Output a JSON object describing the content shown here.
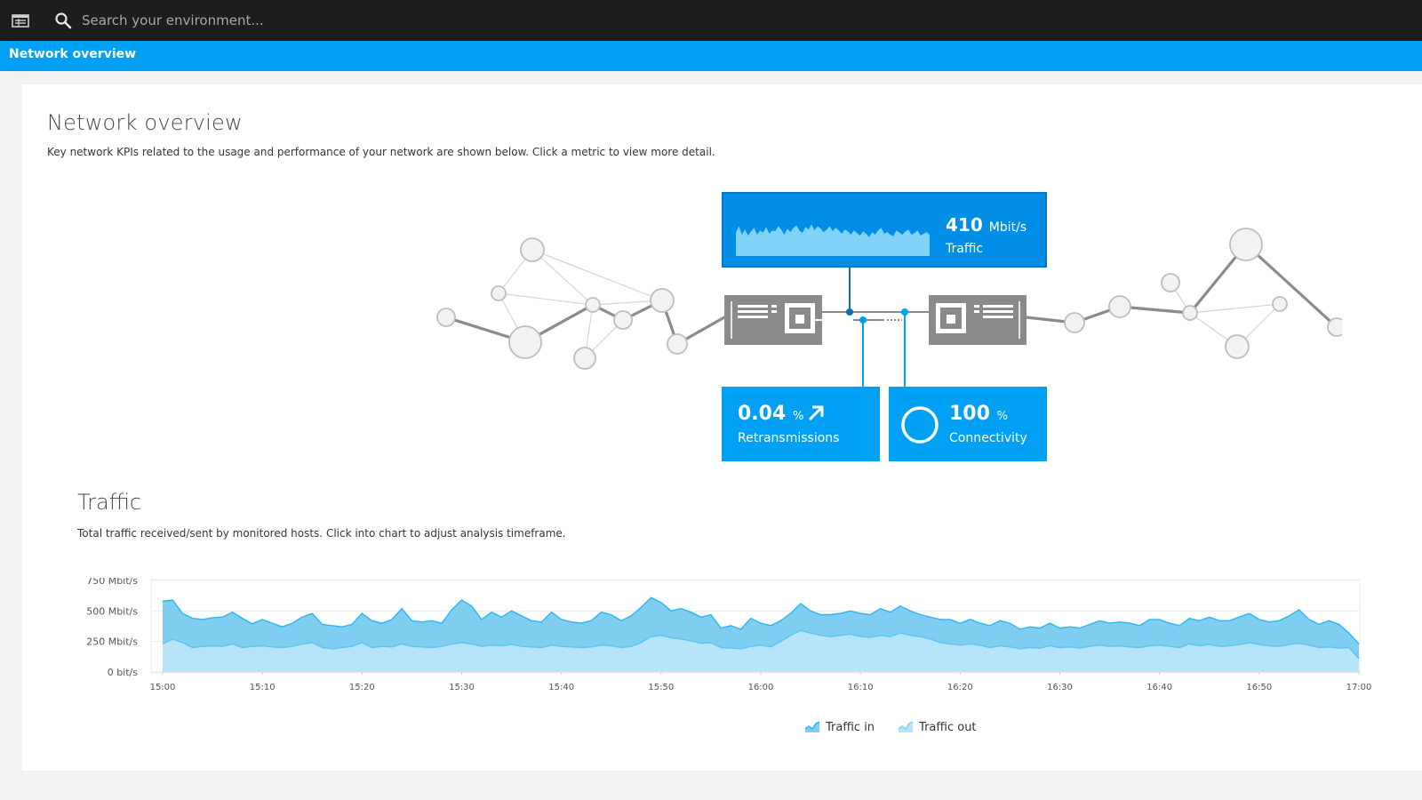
{
  "topbar": {
    "search_placeholder": "Search your environment..."
  },
  "titlebar": {
    "title": "Network overview"
  },
  "overview": {
    "title": "Network overview",
    "description": "Key network KPIs related to the usage and performance of your network are shown below. Click a metric to view more detail."
  },
  "kpis": {
    "traffic": {
      "value": "410",
      "unit": "Mbit/s",
      "label": "Traffic"
    },
    "retransmissions": {
      "value": "0.04",
      "unit": "%",
      "label": "Retransmissions"
    },
    "connectivity": {
      "value": "100",
      "unit": "%",
      "label": "Connectivity"
    }
  },
  "traffic_section": {
    "title": "Traffic",
    "description": "Total traffic received/sent by monitored hosts. Click into chart to adjust analysis timeframe."
  },
  "colors": {
    "accent": "#00a1f5",
    "traffic_in": "#7fcdf1",
    "traffic_out": "#b6e5fa",
    "topbar": "#1d1d1d"
  },
  "chart_data": {
    "type": "area",
    "y_unit_labels": [
      "0 bit/s",
      "250 Mbit/s",
      "500 Mbit/s",
      "750 Mbit/s"
    ],
    "y_ticks": [
      0,
      250,
      500,
      750
    ],
    "ylim": [
      0,
      750
    ],
    "x_tick_labels": [
      "15:00",
      "15:10",
      "15:20",
      "15:30",
      "15:40",
      "15:50",
      "16:00",
      "16:10",
      "16:20",
      "16:30",
      "16:40",
      "16:50",
      "17:00"
    ],
    "x_range_minutes": [
      0,
      120
    ],
    "grid": true,
    "legend_position": "bottom-center",
    "series": [
      {
        "name": "Traffic in",
        "points": [
          [
            0,
            580
          ],
          [
            1,
            590
          ],
          [
            2,
            480
          ],
          [
            3,
            440
          ],
          [
            4,
            430
          ],
          [
            5,
            445
          ],
          [
            6,
            450
          ],
          [
            7,
            490
          ],
          [
            8,
            440
          ],
          [
            9,
            395
          ],
          [
            10,
            430
          ],
          [
            11,
            400
          ],
          [
            12,
            370
          ],
          [
            13,
            400
          ],
          [
            14,
            450
          ],
          [
            15,
            480
          ],
          [
            16,
            390
          ],
          [
            17,
            380
          ],
          [
            18,
            370
          ],
          [
            19,
            390
          ],
          [
            20,
            480
          ],
          [
            21,
            420
          ],
          [
            22,
            400
          ],
          [
            23,
            430
          ],
          [
            24,
            520
          ],
          [
            25,
            420
          ],
          [
            26,
            410
          ],
          [
            27,
            420
          ],
          [
            28,
            400
          ],
          [
            29,
            510
          ],
          [
            30,
            590
          ],
          [
            31,
            540
          ],
          [
            32,
            430
          ],
          [
            33,
            490
          ],
          [
            34,
            450
          ],
          [
            35,
            500
          ],
          [
            36,
            460
          ],
          [
            37,
            420
          ],
          [
            38,
            410
          ],
          [
            39,
            490
          ],
          [
            40,
            430
          ],
          [
            41,
            410
          ],
          [
            42,
            400
          ],
          [
            43,
            420
          ],
          [
            44,
            490
          ],
          [
            45,
            470
          ],
          [
            46,
            420
          ],
          [
            47,
            460
          ],
          [
            48,
            530
          ],
          [
            49,
            610
          ],
          [
            50,
            570
          ],
          [
            51,
            500
          ],
          [
            52,
            520
          ],
          [
            53,
            490
          ],
          [
            54,
            450
          ],
          [
            55,
            470
          ],
          [
            56,
            360
          ],
          [
            57,
            380
          ],
          [
            58,
            350
          ],
          [
            59,
            440
          ],
          [
            60,
            400
          ],
          [
            61,
            380
          ],
          [
            62,
            420
          ],
          [
            63,
            480
          ],
          [
            64,
            560
          ],
          [
            65,
            500
          ],
          [
            66,
            470
          ],
          [
            67,
            470
          ],
          [
            68,
            480
          ],
          [
            69,
            500
          ],
          [
            70,
            480
          ],
          [
            71,
            470
          ],
          [
            72,
            520
          ],
          [
            73,
            490
          ],
          [
            74,
            540
          ],
          [
            75,
            500
          ],
          [
            76,
            470
          ],
          [
            77,
            450
          ],
          [
            78,
            430
          ],
          [
            79,
            430
          ],
          [
            80,
            400
          ],
          [
            81,
            430
          ],
          [
            82,
            400
          ],
          [
            83,
            380
          ],
          [
            84,
            420
          ],
          [
            85,
            400
          ],
          [
            86,
            350
          ],
          [
            87,
            370
          ],
          [
            88,
            360
          ],
          [
            89,
            400
          ],
          [
            90,
            360
          ],
          [
            91,
            370
          ],
          [
            92,
            360
          ],
          [
            93,
            390
          ],
          [
            94,
            420
          ],
          [
            95,
            400
          ],
          [
            96,
            410
          ],
          [
            97,
            400
          ],
          [
            98,
            380
          ],
          [
            99,
            430
          ],
          [
            100,
            430
          ],
          [
            101,
            400
          ],
          [
            102,
            380
          ],
          [
            103,
            440
          ],
          [
            104,
            420
          ],
          [
            105,
            450
          ],
          [
            106,
            420
          ],
          [
            107,
            420
          ],
          [
            108,
            450
          ],
          [
            109,
            480
          ],
          [
            110,
            430
          ],
          [
            111,
            410
          ],
          [
            112,
            420
          ],
          [
            113,
            460
          ],
          [
            114,
            510
          ],
          [
            115,
            430
          ],
          [
            116,
            390
          ],
          [
            117,
            420
          ],
          [
            118,
            390
          ],
          [
            119,
            320
          ],
          [
            120,
            230
          ]
        ]
      },
      {
        "name": "Traffic out",
        "points": [
          [
            0,
            230
          ],
          [
            1,
            270
          ],
          [
            2,
            240
          ],
          [
            3,
            200
          ],
          [
            4,
            210
          ],
          [
            5,
            215
          ],
          [
            6,
            210
          ],
          [
            7,
            230
          ],
          [
            8,
            200
          ],
          [
            9,
            210
          ],
          [
            10,
            215
          ],
          [
            11,
            205
          ],
          [
            12,
            200
          ],
          [
            13,
            210
          ],
          [
            14,
            230
          ],
          [
            15,
            240
          ],
          [
            16,
            200
          ],
          [
            17,
            190
          ],
          [
            18,
            200
          ],
          [
            19,
            210
          ],
          [
            20,
            240
          ],
          [
            21,
            200
          ],
          [
            22,
            210
          ],
          [
            23,
            205
          ],
          [
            24,
            230
          ],
          [
            25,
            210
          ],
          [
            26,
            205
          ],
          [
            27,
            200
          ],
          [
            28,
            210
          ],
          [
            29,
            230
          ],
          [
            30,
            240
          ],
          [
            31,
            230
          ],
          [
            32,
            210
          ],
          [
            33,
            220
          ],
          [
            34,
            215
          ],
          [
            35,
            225
          ],
          [
            36,
            210
          ],
          [
            37,
            205
          ],
          [
            38,
            200
          ],
          [
            39,
            220
          ],
          [
            40,
            210
          ],
          [
            41,
            205
          ],
          [
            42,
            200
          ],
          [
            43,
            205
          ],
          [
            44,
            220
          ],
          [
            45,
            215
          ],
          [
            46,
            200
          ],
          [
            47,
            210
          ],
          [
            48,
            240
          ],
          [
            49,
            290
          ],
          [
            50,
            300
          ],
          [
            51,
            280
          ],
          [
            52,
            270
          ],
          [
            53,
            255
          ],
          [
            54,
            235
          ],
          [
            55,
            240
          ],
          [
            56,
            200
          ],
          [
            57,
            195
          ],
          [
            58,
            190
          ],
          [
            59,
            210
          ],
          [
            60,
            220
          ],
          [
            61,
            205
          ],
          [
            62,
            250
          ],
          [
            63,
            300
          ],
          [
            64,
            340
          ],
          [
            65,
            320
          ],
          [
            66,
            300
          ],
          [
            67,
            290
          ],
          [
            68,
            300
          ],
          [
            69,
            310
          ],
          [
            70,
            290
          ],
          [
            71,
            285
          ],
          [
            72,
            300
          ],
          [
            73,
            290
          ],
          [
            74,
            320
          ],
          [
            75,
            300
          ],
          [
            76,
            290
          ],
          [
            77,
            270
          ],
          [
            78,
            240
          ],
          [
            79,
            230
          ],
          [
            80,
            220
          ],
          [
            81,
            230
          ],
          [
            82,
            220
          ],
          [
            83,
            200
          ],
          [
            84,
            215
          ],
          [
            85,
            205
          ],
          [
            86,
            190
          ],
          [
            87,
            200
          ],
          [
            88,
            195
          ],
          [
            89,
            215
          ],
          [
            90,
            200
          ],
          [
            91,
            205
          ],
          [
            92,
            195
          ],
          [
            93,
            210
          ],
          [
            94,
            220
          ],
          [
            95,
            210
          ],
          [
            96,
            215
          ],
          [
            97,
            205
          ],
          [
            98,
            200
          ],
          [
            99,
            215
          ],
          [
            100,
            220
          ],
          [
            101,
            210
          ],
          [
            102,
            200
          ],
          [
            103,
            230
          ],
          [
            104,
            215
          ],
          [
            105,
            225
          ],
          [
            106,
            210
          ],
          [
            107,
            215
          ],
          [
            108,
            225
          ],
          [
            109,
            240
          ],
          [
            110,
            225
          ],
          [
            111,
            215
          ],
          [
            112,
            210
          ],
          [
            113,
            225
          ],
          [
            114,
            235
          ],
          [
            115,
            220
          ],
          [
            116,
            200
          ],
          [
            117,
            205
          ],
          [
            118,
            195
          ],
          [
            119,
            200
          ],
          [
            120,
            110
          ]
        ]
      }
    ]
  },
  "sparkline": {
    "values": [
      0.55,
      0.7,
      0.5,
      0.62,
      0.48,
      0.58,
      0.66,
      0.5,
      0.6,
      0.55,
      0.68,
      0.52,
      0.6,
      0.58,
      0.7,
      0.62,
      0.5,
      0.64,
      0.56,
      0.66,
      0.72,
      0.6,
      0.54,
      0.68,
      0.62,
      0.74,
      0.6,
      0.7,
      0.64,
      0.56,
      0.62,
      0.7,
      0.58,
      0.66,
      0.6,
      0.52,
      0.62,
      0.58,
      0.5,
      0.6,
      0.54,
      0.48,
      0.58,
      0.52,
      0.44,
      0.56,
      0.5,
      0.6,
      0.66,
      0.52,
      0.56,
      0.5,
      0.46,
      0.6,
      0.55,
      0.5,
      0.58,
      0.62,
      0.5,
      0.54,
      0.6,
      0.48,
      0.52,
      0.56,
      0.5
    ]
  }
}
